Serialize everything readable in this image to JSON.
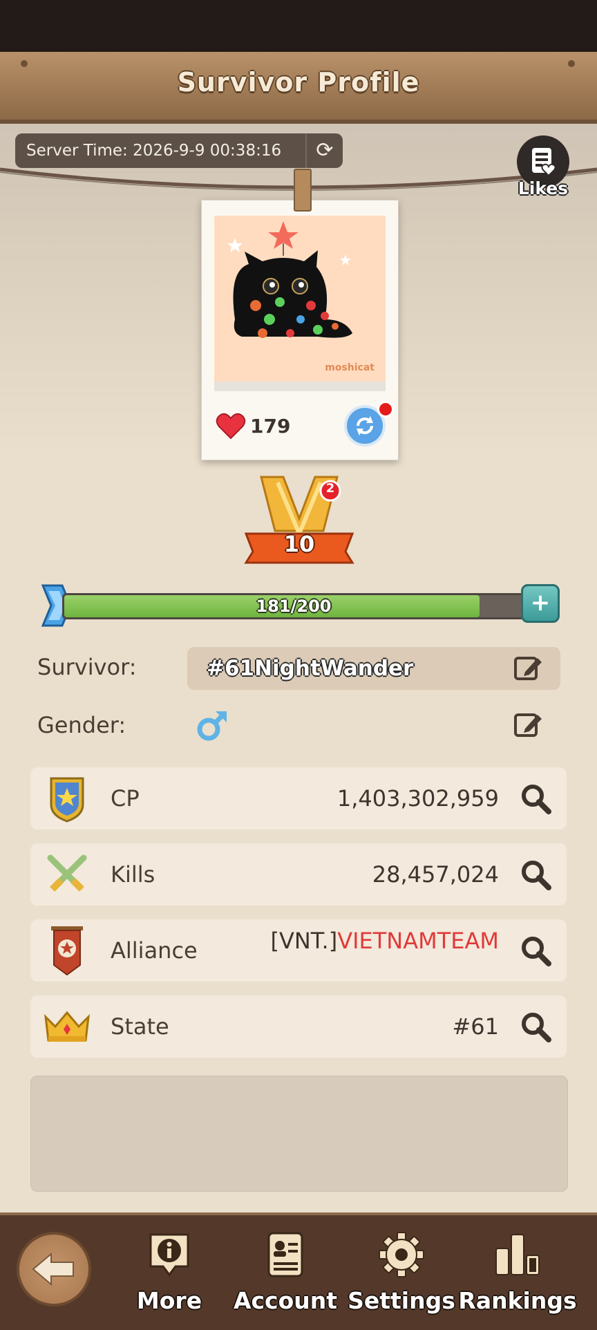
{
  "header": {
    "title": "Survivor Profile"
  },
  "server_time": {
    "text": "Server Time: 2026-9-9 00:38:16",
    "refresh_icon": "refresh-icon"
  },
  "likes_button": {
    "label": "Likes",
    "icon": "document-heart-icon"
  },
  "avatar": {
    "photo_watermark": "moshicat",
    "likes": "179",
    "refresh_icon": "refresh-icon"
  },
  "rank": {
    "level": "10",
    "notification_count": "2"
  },
  "xp": {
    "text": "181/200",
    "progress": 0.905
  },
  "survivor": {
    "label": "Survivor:",
    "name": "#61NightWander"
  },
  "gender": {
    "label": "Gender:",
    "symbol": "♂",
    "color": "#5fb3e6"
  },
  "stats": [
    {
      "label": "CP",
      "value": "1,403,302,959",
      "icon": "shield-star-icon"
    },
    {
      "label": "Kills",
      "value": "28,457,024",
      "icon": "crossed-swords-icon"
    },
    {
      "label": "Alliance",
      "tag": "[VNT.]",
      "name": "VIETNAMTEAM",
      "icon": "alliance-banner-icon"
    },
    {
      "label": "State",
      "value": "#61",
      "icon": "crown-icon"
    }
  ],
  "bottom_nav": {
    "back_icon": "back-arrow-icon",
    "items": [
      {
        "label": "More",
        "icon": "info-icon"
      },
      {
        "label": "Account",
        "icon": "id-card-icon"
      },
      {
        "label": "Settings",
        "icon": "gear-icon"
      },
      {
        "label": "Rankings",
        "icon": "bar-chart-icon"
      }
    ]
  },
  "colors": {
    "accent_red": "#e03a3a",
    "xp_green": "#7ec451",
    "brown": "#54392a"
  }
}
